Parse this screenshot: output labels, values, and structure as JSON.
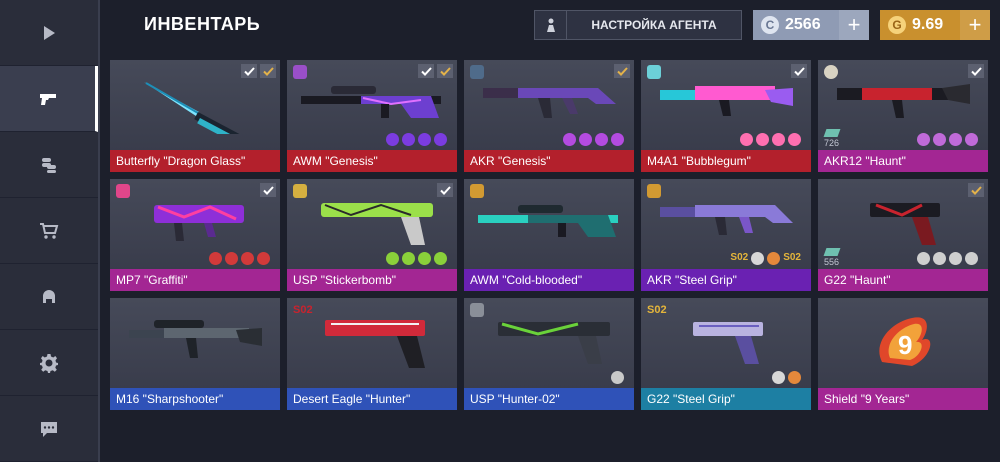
{
  "header": {
    "title": "ИНВЕНТАРЬ",
    "agent_button": "НАСТРОЙКА АГЕНТА",
    "silver": {
      "coin": "C",
      "amount": "2566",
      "plus": "+"
    },
    "gold": {
      "coin": "G",
      "amount": "9.69",
      "plus": "+"
    }
  },
  "sidebar": {
    "items": [
      {
        "name": "play-icon"
      },
      {
        "name": "pistol-icon"
      },
      {
        "name": "coins-icon"
      },
      {
        "name": "cart-icon"
      },
      {
        "name": "helmet-icon"
      },
      {
        "name": "gear-icon"
      },
      {
        "name": "chat-icon"
      }
    ]
  },
  "items": [
    {
      "label": "Butterfly \"Dragon Glass\"",
      "rarity_color": "#b3202c"
    },
    {
      "label": "AWM \"Genesis\"",
      "rarity_color": "#b3202c"
    },
    {
      "label": "AKR \"Genesis\"",
      "rarity_color": "#b3202c"
    },
    {
      "label": "M4A1 \"Bubblegum\"",
      "rarity_color": "#b3202c"
    },
    {
      "label": "AKR12 \"Haunt\"",
      "rarity_color": "#a32693",
      "count": "726"
    },
    {
      "label": "MP7 \"Graffiti\"",
      "rarity_color": "#a32693"
    },
    {
      "label": "USP \"Stickerbomb\"",
      "rarity_color": "#a32693"
    },
    {
      "label": "AWM \"Cold-blooded\"",
      "rarity_color": "#6a21b2"
    },
    {
      "label": "AKR \"Steel Grip\"",
      "rarity_color": "#6a21b2"
    },
    {
      "label": "G22 \"Haunt\"",
      "rarity_color": "#a32693",
      "count": "556"
    },
    {
      "label": "M16 \"Sharpshooter\"",
      "rarity_color": "#2f52b8"
    },
    {
      "label": "Desert Eagle \"Hunter\"",
      "rarity_color": "#2f52b8"
    },
    {
      "label": "USP \"Hunter-02\"",
      "rarity_color": "#2f52b8"
    },
    {
      "label": "G22 \"Steel Grip\"",
      "rarity_color": "#1d7fa3"
    },
    {
      "label": "Shield \"9 Years\"",
      "rarity_color": "#a32693"
    }
  ],
  "sticker_text": {
    "s02": "S02"
  }
}
